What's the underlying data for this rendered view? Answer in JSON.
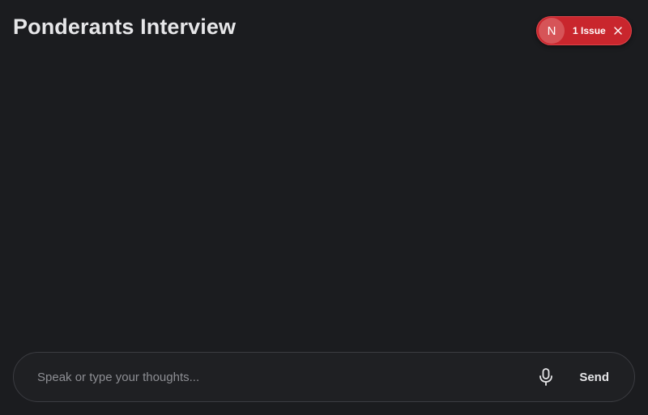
{
  "header": {
    "title": "Ponderants Interview"
  },
  "issues_indicator": {
    "avatar_letter": "N",
    "label": "1 Issue",
    "close_icon": "close-icon"
  },
  "composer": {
    "placeholder": "Speak or type your thoughts...",
    "value": "",
    "mic_icon": "microphone-icon",
    "send_label": "Send"
  },
  "colors": {
    "background": "#1b1c1f",
    "issue_red": "#c9262d",
    "text": "#e6e6e8"
  }
}
